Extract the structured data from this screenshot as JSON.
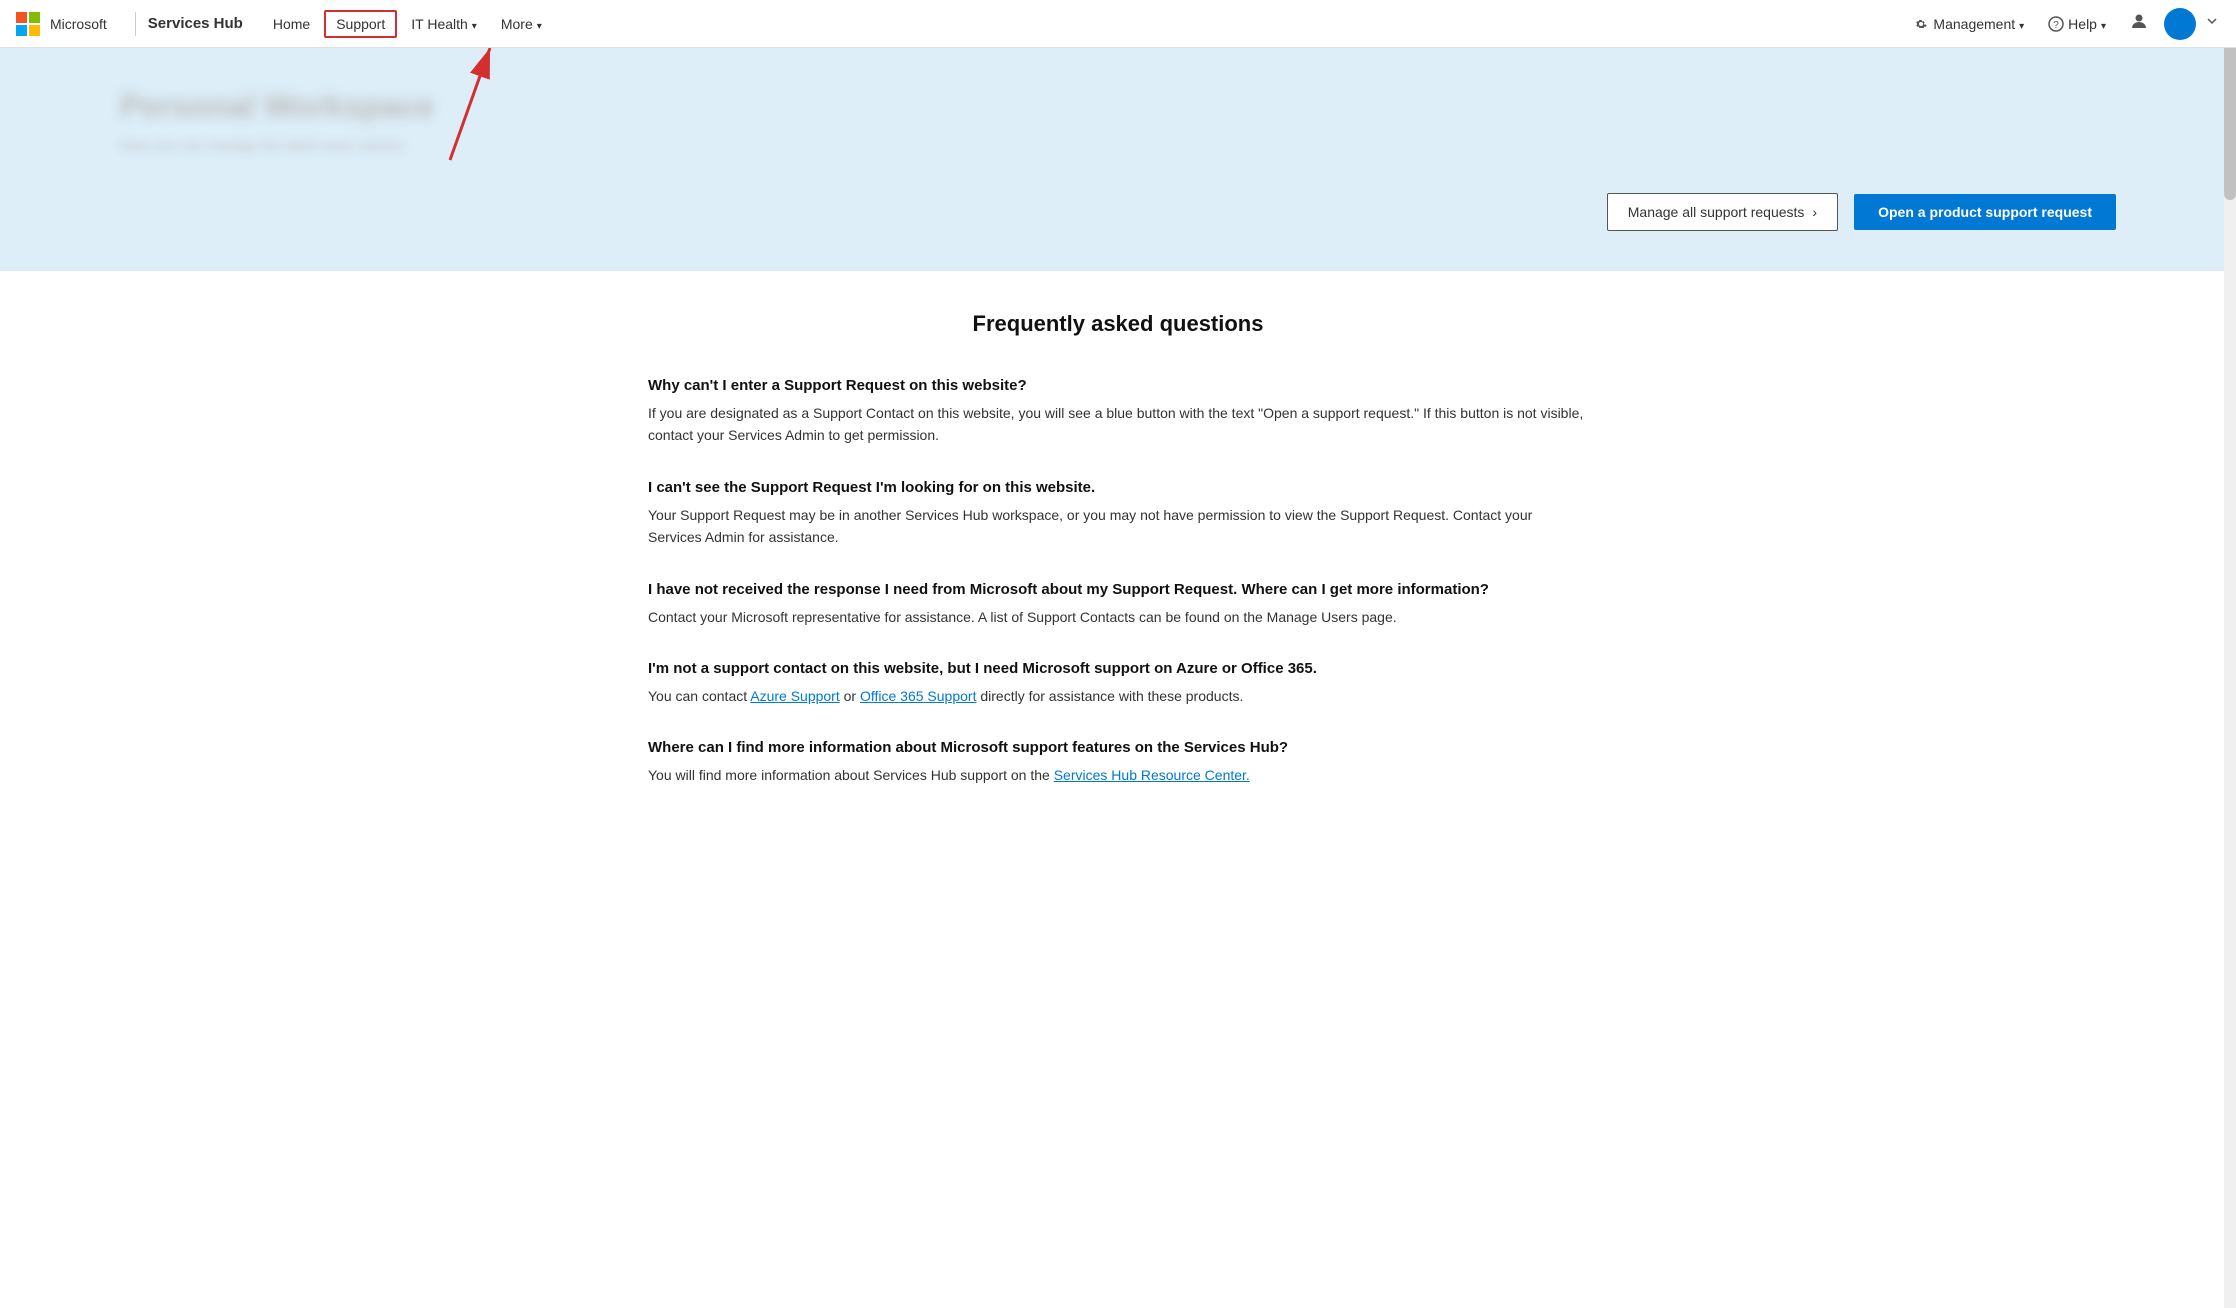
{
  "nav": {
    "brand": "Services Hub",
    "home_label": "Home",
    "support_label": "Support",
    "it_health_label": "IT Health",
    "more_label": "More",
    "management_label": "Management",
    "help_label": "Help"
  },
  "hero": {
    "title": "Personal Workspace",
    "subtitle": "Here you can manage the latest news articles.",
    "manage_btn": "Manage all support requests",
    "open_btn": "Open a product support request"
  },
  "faq": {
    "heading": "Frequently asked questions",
    "items": [
      {
        "question": "Why can't I enter a Support Request on this website?",
        "answer": "If you are designated as a Support Contact on this website, you will see a blue button with the text \"Open a support request.\" If this button is not visible, contact your Services Admin to get permission."
      },
      {
        "question": "I can't see the Support Request I'm looking for on this website.",
        "answer": "Your Support Request may be in another Services Hub workspace, or you may not have permission to view the Support Request. Contact your Services Admin for assistance."
      },
      {
        "question": "I have not received the response I need from Microsoft about my Support Request. Where can I get more information?",
        "answer": "Contact your Microsoft representative for assistance. A list of Support Contacts can be found on the Manage Users page."
      },
      {
        "question": "I'm not a support contact on this website, but I need Microsoft support on Azure or Office 365.",
        "answer_before_link1": "You can contact ",
        "link1_text": "Azure Support",
        "link1_href": "#",
        "answer_between": " or ",
        "link2_text": "Office 365 Support",
        "link2_href": "#",
        "answer_after": " directly for assistance with these products."
      },
      {
        "question": "Where can I find more information about Microsoft support features on the Services Hub?",
        "answer_before_link": "You will find more information about Services Hub support on the ",
        "link_text": "Services Hub Resource Center.",
        "link_href": "#"
      }
    ]
  }
}
